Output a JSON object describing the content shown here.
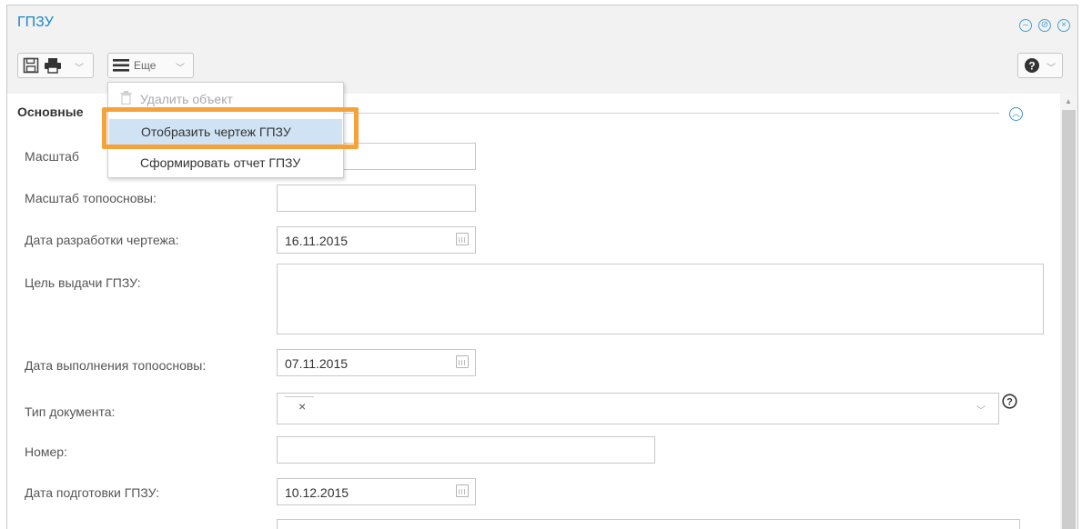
{
  "window": {
    "title": "ГПЗУ",
    "controls": [
      "minimize-icon",
      "restore-icon",
      "close-icon"
    ]
  },
  "toolbar": {
    "more_label": "Еще",
    "icons": [
      "save-icon",
      "print-icon",
      "menu-icon",
      "help-icon"
    ]
  },
  "dropdown": {
    "items": [
      {
        "label": "Удалить объект",
        "icon": "trash-icon",
        "disabled": true
      },
      {
        "label": "Отобразить чертеж ГПЗУ",
        "highlighted": true
      },
      {
        "label": "Сформировать отчет ГПЗУ"
      }
    ]
  },
  "section": {
    "title": "Основные"
  },
  "form": {
    "scale_drawing": {
      "label": "Масштаб",
      "value": ""
    },
    "scale_topo": {
      "label": "Масштаб топоосновы:",
      "value": ""
    },
    "drawing_date": {
      "label": "Дата разработки чертежа:",
      "value": "16.11.2015"
    },
    "purpose": {
      "label": "Цель выдачи ГПЗУ:",
      "value": ""
    },
    "topo_date": {
      "label": "Дата выполнения топоосновы:",
      "value": "07.11.2015"
    },
    "doc_type": {
      "label": "Тип документа:",
      "value": ""
    },
    "number": {
      "label": "Номер:",
      "value": ""
    },
    "prep_date": {
      "label": "Дата подготовки ГПЗУ:",
      "value": "10.12.2015"
    }
  },
  "colors": {
    "accent": "#1a86c5",
    "highlight_border": "#f5a23a",
    "menu_selected_bg": "#cfe3f4"
  }
}
